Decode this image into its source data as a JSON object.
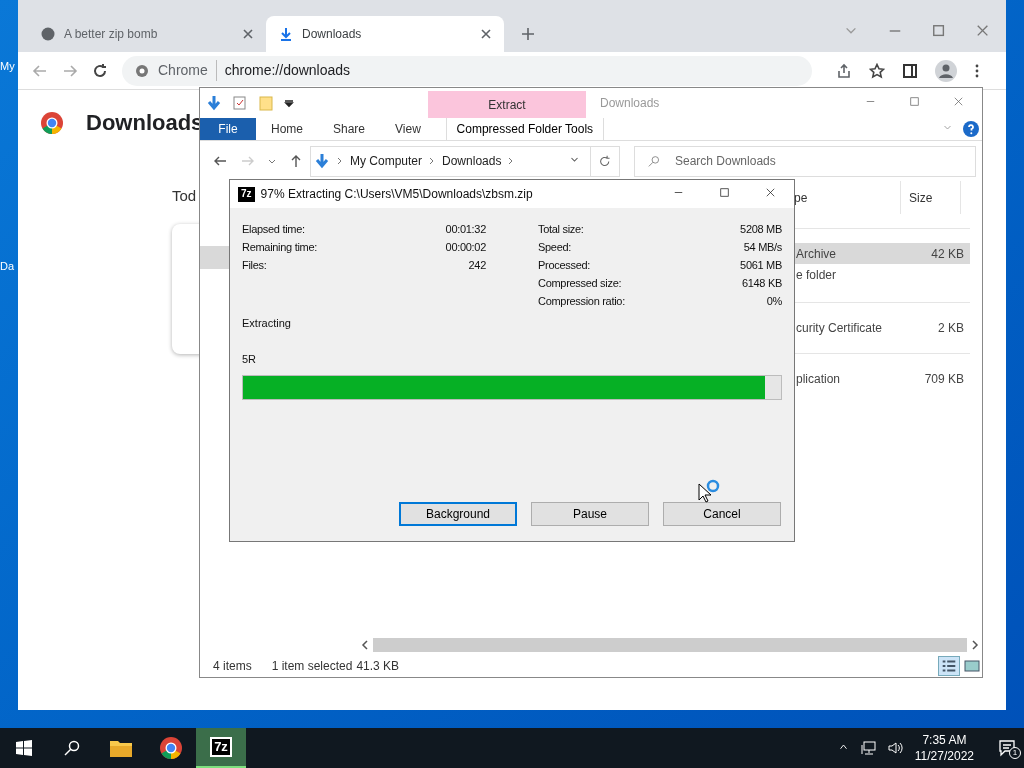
{
  "desktop": {
    "icon_labels": [
      "My",
      "Da"
    ]
  },
  "chrome": {
    "tabs": [
      {
        "title": "A better zip bomb",
        "kind": "web",
        "selected": false
      },
      {
        "title": "Downloads",
        "kind": "download",
        "selected": true
      }
    ],
    "address": {
      "chip": "Chrome",
      "url": "chrome://downloads"
    },
    "page": {
      "heading": "Downloads",
      "date_label": "Tod"
    }
  },
  "explorer": {
    "contextual_tab": "Extract",
    "title": "Downloads",
    "ribbon_tabs": [
      {
        "label": "File",
        "kind": "file"
      },
      {
        "label": "Home",
        "kind": "tab"
      },
      {
        "label": "Share",
        "kind": "tab"
      },
      {
        "label": "View",
        "kind": "tab"
      },
      {
        "label": "Compressed Folder Tools",
        "kind": "contextual"
      }
    ],
    "breadcrumb": [
      "My Computer",
      "Downloads"
    ],
    "search": {
      "placeholder": "Search Downloads"
    },
    "columns": [
      "pe",
      "Size"
    ],
    "groups": [
      {
        "rows": [
          {
            "type": "Archive",
            "size": "42 KB",
            "selected": true
          },
          {
            "type": "e folder",
            "size": "",
            "selected": false
          }
        ]
      },
      {
        "rows": [
          {
            "type": "curity Certificate",
            "size": "2 KB",
            "selected": false
          }
        ]
      },
      {
        "rows": [
          {
            "type": "plication",
            "size": "709 KB",
            "selected": false
          }
        ]
      }
    ],
    "status": {
      "count": "4 items",
      "selection": "1 item selected",
      "size": "41.3 KB"
    }
  },
  "dialog": {
    "logo_text": "7z",
    "title": "97% Extracting C:\\Users\\VM5\\Downloads\\zbsm.zip",
    "left_stats": [
      {
        "label": "Elapsed time:",
        "value": "00:01:32"
      },
      {
        "label": "Remaining time:",
        "value": "00:00:02"
      },
      {
        "label": "Files:",
        "value": "242"
      }
    ],
    "right_stats": [
      {
        "label": "Total size:",
        "value": "5208 MB"
      },
      {
        "label": "Speed:",
        "value": "54 MB/s"
      },
      {
        "label": "Processed:",
        "value": "5061 MB"
      },
      {
        "label": "Compressed size:",
        "value": "6148 KB"
      },
      {
        "label": "Compression ratio:",
        "value": "0%"
      }
    ],
    "status_label": "Extracting",
    "current_file": "5R",
    "progress": {
      "level": 0.97
    },
    "buttons": [
      {
        "label": "Background",
        "focused": true
      },
      {
        "label": "Pause",
        "focused": false
      },
      {
        "label": "Cancel",
        "focused": false
      }
    ]
  },
  "taskbar": {
    "apps": [
      {
        "kind": "explorer",
        "active": false
      },
      {
        "kind": "chrome",
        "active": false
      },
      {
        "kind": "sevenzip",
        "label": "7z",
        "active": true
      }
    ],
    "time": "7:35 AM",
    "date": "11/27/2022",
    "notification_count": "1"
  }
}
